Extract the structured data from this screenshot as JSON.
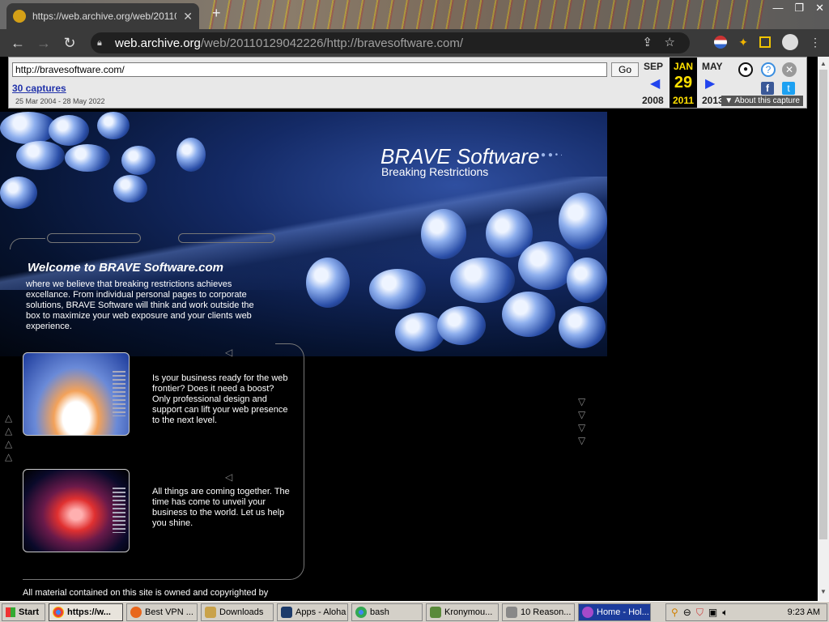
{
  "browser": {
    "tab_title": "https://web.archive.org/web/20110",
    "tab_close": "✕",
    "new_tab": "+",
    "window_controls": [
      "—",
      "❐",
      "✕"
    ],
    "url_host": "web.archive.org",
    "url_path": "/web/20110129042226/http://bravesoftware.com/"
  },
  "wayback": {
    "url_value": "http://bravesoftware.com/",
    "go_label": "Go",
    "captures_link": "30 captures",
    "date_range": "25 Mar 2004 - 28 May 2022",
    "prev_month": "SEP",
    "prev_year": "2008",
    "cur_month": "JAN",
    "cur_day": "29",
    "cur_year": "2011",
    "next_month": "MAY",
    "next_year": "2013",
    "about_label": "▼ About this capture"
  },
  "site": {
    "brand": "BRAVE Software",
    "slogan": "Breaking Restrictions",
    "welcome": "Welcome to BRAVE Software.com",
    "intro": "where we believe that breaking restrictions achieves excellance. From individual personal pages to corporate solutions, BRAVE Software will think and work outside the box to maximize your web exposure and your clients web experience.",
    "blurb1": "Is your business ready for the web frontier? Does it need a boost? Only professional design and support can lift your web presence to the next level.",
    "blurb2": "All things are coming together. The time has come to unveil your business to the world. Let us help you shine.",
    "footer": "All material contained on this site is owned and copyrighted by"
  },
  "taskbar": {
    "start": "Start",
    "tasks": [
      "https://w...",
      "Best VPN ...",
      "Downloads",
      "Apps - Aloha",
      "bash",
      "Kronymou...",
      "10 Reason...",
      "Home - Hol..."
    ],
    "clock": "9:23 AM"
  },
  "colors": {
    "wayback_blue": "#2244ee",
    "capture_yellow": "#ffe000",
    "taskbar_gray": "#d4d0c8"
  }
}
